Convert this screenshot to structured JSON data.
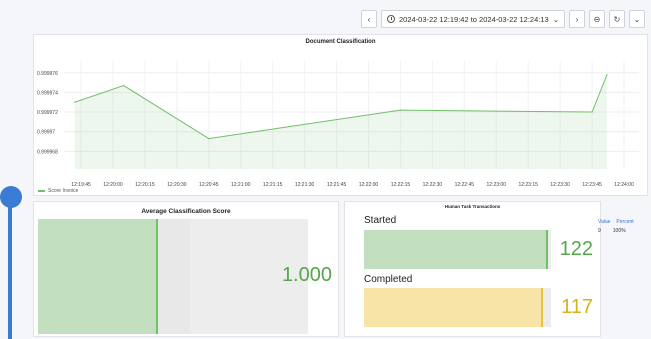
{
  "toolbar": {
    "time_range": "2024-03-22 12:19:42 to 2024-03-22 12:24:13",
    "prev_icon": "chevron-left-icon",
    "next_icon": "chevron-right-icon",
    "zoom_icon": "zoom-out-icon",
    "refresh_icon": "refresh-icon"
  },
  "doc_panel": {
    "title": "Document Classification",
    "legend": "Score Invoice"
  },
  "chart_data": {
    "type": "area",
    "title": "Document Classification",
    "x": [
      "12:19:42",
      "12:20:05",
      "12:20:45",
      "12:22:15",
      "12:23:45",
      "12:23:52"
    ],
    "series": [
      {
        "name": "Score Invoice",
        "values": [
          0.999973,
          0.9999747,
          0.9999693,
          0.9999722,
          0.999972,
          0.9999758
        ]
      }
    ],
    "y_ticks": [
      "0.999976",
      "0.999974",
      "0.999972",
      "0.99997",
      "0.999968"
    ],
    "x_ticks": [
      "12:19:45",
      "12:20:00",
      "12:20:15",
      "12:20:30",
      "12:20:45",
      "12:21:00",
      "12:21:15",
      "12:21:30",
      "12:21:45",
      "12:22:00",
      "12:22:15",
      "12:22:30",
      "12:22:45",
      "12:23:00",
      "12:23:15",
      "12:23:30",
      "12:23:45",
      "12:24:00"
    ],
    "ylim": [
      0.9999662,
      0.9999772
    ],
    "legend_position": "bottom-left",
    "color": "#73bf69"
  },
  "avg_panel": {
    "title": "Average Classification Score",
    "value": "1.000",
    "fill_fraction": 0.445
  },
  "task_panel": {
    "title": "Human Task Transactions",
    "rows": [
      {
        "label": "Started",
        "value": "122",
        "fill_fraction": 0.985,
        "color": "#c2dfc0",
        "edge": "#73bf69",
        "text_color": "#56a64b"
      },
      {
        "label": "Completed",
        "value": "117",
        "fill_fraction": 0.955,
        "color": "#f7e4a6",
        "edge": "#e5c43a",
        "text_color": "#d6b21c"
      }
    ]
  },
  "mini_table": {
    "headers": [
      "Value",
      "Percent"
    ],
    "row": [
      "9",
      "100%"
    ]
  }
}
